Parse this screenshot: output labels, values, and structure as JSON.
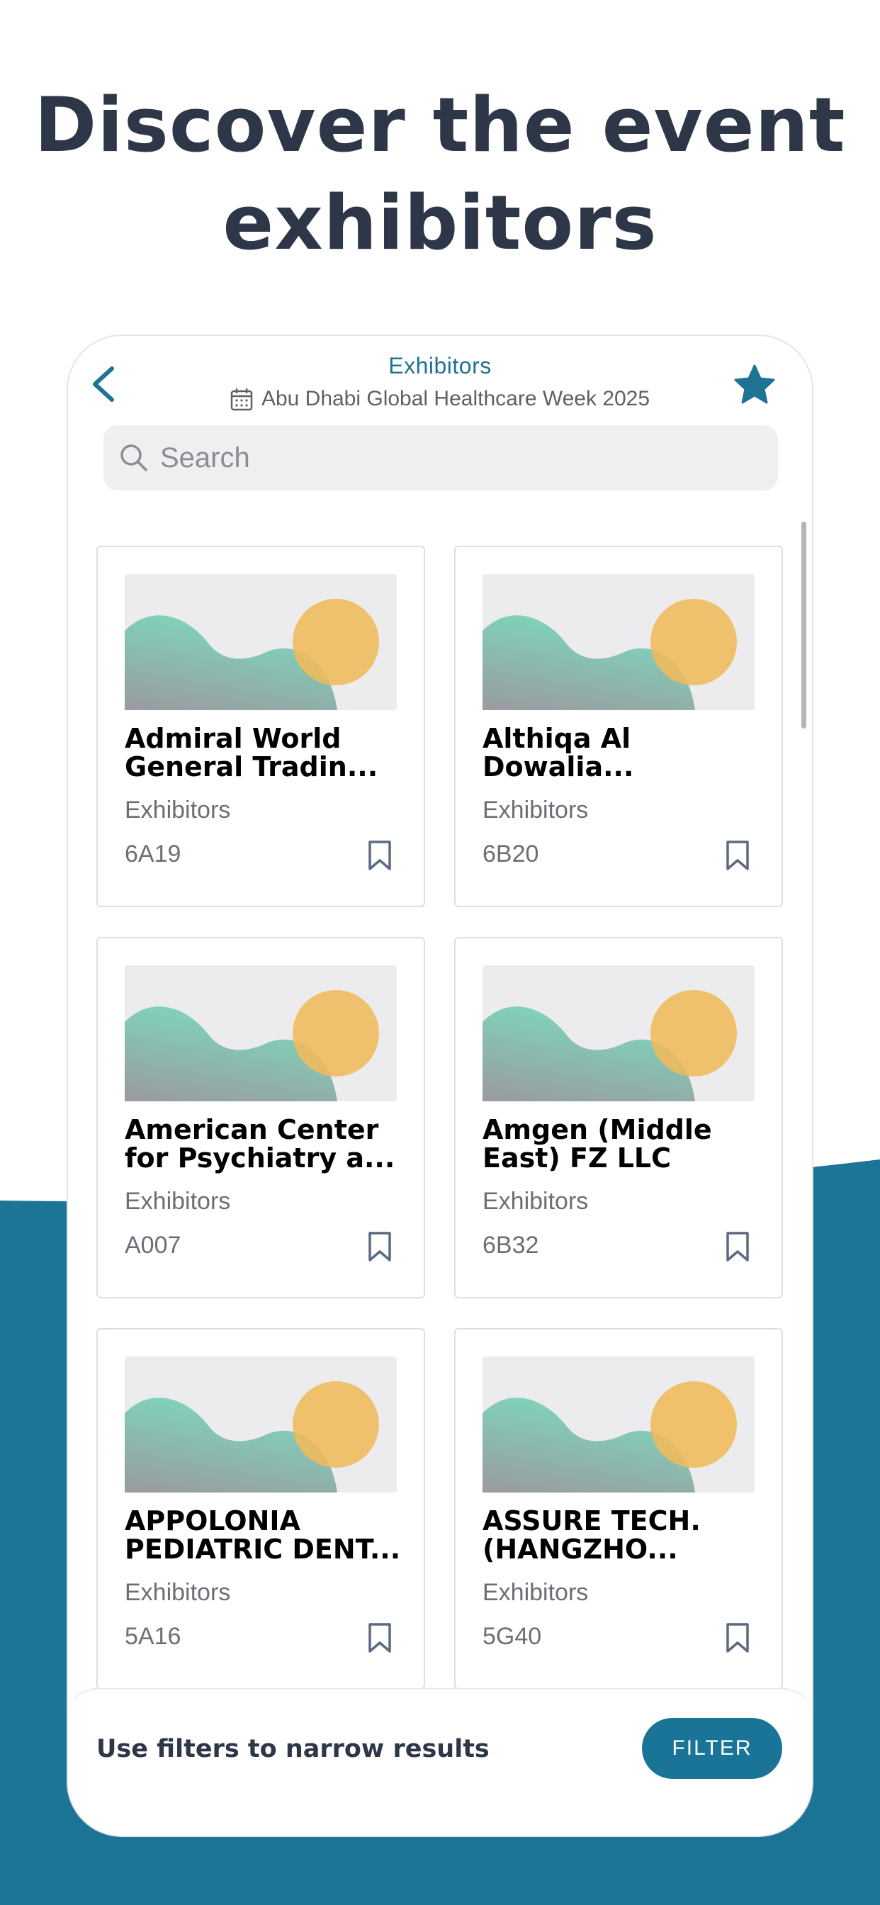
{
  "headline": {
    "line1": "Discover the event",
    "line2": "exhibitors"
  },
  "header": {
    "title": "Exhibitors",
    "event_name": "Abu Dhabi Global Healthcare Week 2025",
    "back_icon": "chevron-left-icon",
    "favorite_icon": "star-icon",
    "calendar_icon": "calendar-icon"
  },
  "search": {
    "placeholder": "Search",
    "value": ""
  },
  "exhibitors": [
    {
      "name": "Admiral World\nGeneral Tradin...",
      "category": "Exhibitors",
      "booth": "6A19"
    },
    {
      "name": "Althiqa Al\nDowalia...",
      "category": "Exhibitors",
      "booth": "6B20"
    },
    {
      "name": "American Center\nfor Psychiatry a...",
      "category": "Exhibitors",
      "booth": "A007"
    },
    {
      "name": "Amgen (Middle\nEast) FZ LLC",
      "category": "Exhibitors",
      "booth": "6B32"
    },
    {
      "name": "APPOLONIA\nPEDIATRIC DENT...",
      "category": "Exhibitors",
      "booth": "5A16"
    },
    {
      "name": "ASSURE TECH.\n(HANGZHO...",
      "category": "Exhibitors",
      "booth": "5G40"
    }
  ],
  "footer": {
    "hint": "Use filters to narrow results",
    "filter_label": "FILTER"
  },
  "colors": {
    "accent": "#1a7497",
    "background_band": "#1c7597",
    "heading": "#2d3748",
    "placeholder_sun": "#f0c16a",
    "placeholder_hill": "#7ed6bb"
  }
}
